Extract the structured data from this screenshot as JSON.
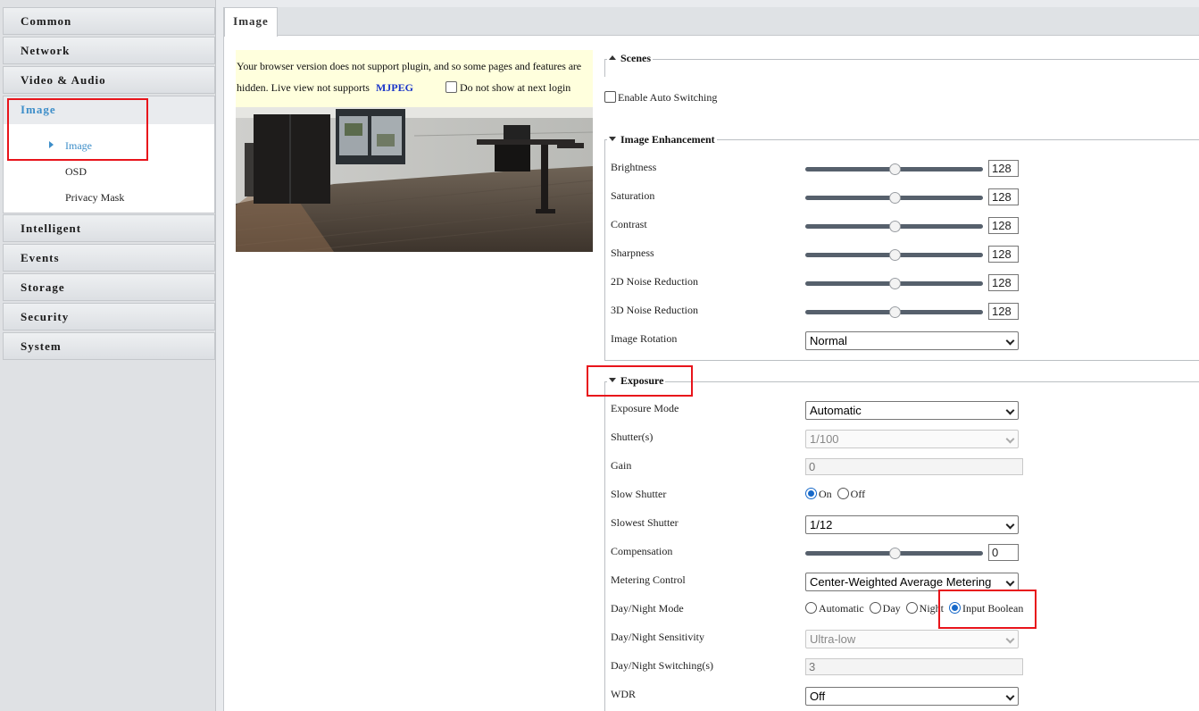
{
  "sidebar": {
    "items": [
      {
        "label": "Common"
      },
      {
        "label": "Network"
      },
      {
        "label": "Video & Audio"
      },
      {
        "label": "Image"
      },
      {
        "label": "Intelligent"
      },
      {
        "label": "Events"
      },
      {
        "label": "Storage"
      },
      {
        "label": "Security"
      },
      {
        "label": "System"
      }
    ],
    "active": "Image",
    "sub_items": [
      {
        "label": "Image",
        "active": true
      },
      {
        "label": "OSD"
      },
      {
        "label": "Privacy Mask"
      }
    ]
  },
  "tabs": [
    {
      "label": "Image"
    }
  ],
  "notice": {
    "line1": "Your browser version does not support plugin, and so some pages and features are",
    "line2": "hidden. Live view not supports",
    "mjpeg": "MJPEG",
    "checkbox_label": "Do not show at next login"
  },
  "scenes": {
    "legend": "Scenes",
    "auto_switch_label": "Enable Auto Switching",
    "auto_switch_checked": false
  },
  "enhancement": {
    "legend": "Image Enhancement",
    "sliders": [
      {
        "label": "Brightness",
        "value": "128",
        "fraction": 0.5
      },
      {
        "label": "Saturation",
        "value": "128",
        "fraction": 0.5
      },
      {
        "label": "Contrast",
        "value": "128",
        "fraction": 0.5
      },
      {
        "label": "Sharpness",
        "value": "128",
        "fraction": 0.5
      },
      {
        "label": "2D Noise Reduction",
        "value": "128",
        "fraction": 0.5
      },
      {
        "label": "3D Noise Reduction",
        "value": "128",
        "fraction": 0.5
      }
    ],
    "rotation_label": "Image Rotation",
    "rotation_value": "Normal"
  },
  "exposure": {
    "legend": "Exposure",
    "mode_label": "Exposure Mode",
    "mode_value": "Automatic",
    "shutter_label": "Shutter(s)",
    "shutter_value": "1/100",
    "gain_label": "Gain",
    "gain_value": "0",
    "slow_shutter_label": "Slow Shutter",
    "slow_shutter_on": "On",
    "slow_shutter_off": "Off",
    "slow_shutter_selected": "On",
    "slowest_shutter_label": "Slowest Shutter",
    "slowest_shutter_value": "1/12",
    "compensation_label": "Compensation",
    "compensation_value": "0",
    "compensation_fraction": 0.5,
    "metering_label": "Metering Control",
    "metering_value": "Center-Weighted Average Metering",
    "daynight_label": "Day/Night Mode",
    "daynight_options": [
      "Automatic",
      "Day",
      "Night",
      "Input Boolean"
    ],
    "daynight_selected": "Input Boolean",
    "sensitivity_label": "Day/Night Sensitivity",
    "sensitivity_value": "Ultra-low",
    "switching_label": "Day/Night Switching(s)",
    "switching_value": "3",
    "wdr_label": "WDR",
    "wdr_value": "Off"
  },
  "colors": {
    "accent": "#3d8ec9",
    "highlight": "#e8141b",
    "slider": "#56606c",
    "notice_bg": "#ffffdd"
  }
}
